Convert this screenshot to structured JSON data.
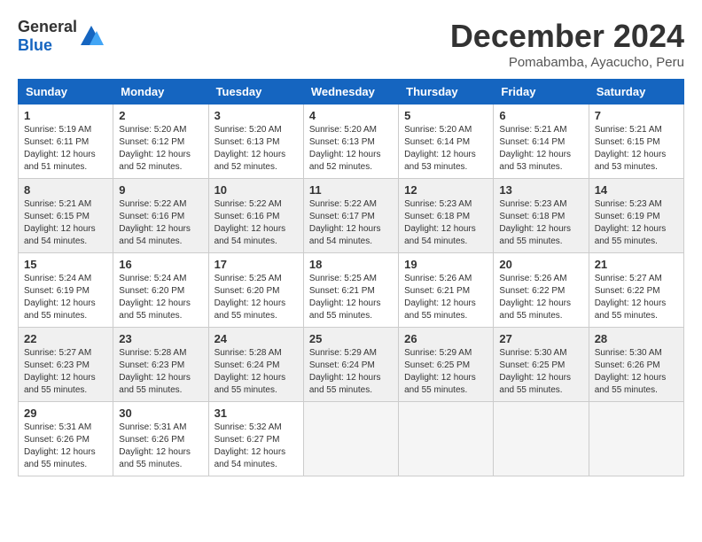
{
  "header": {
    "logo_general": "General",
    "logo_blue": "Blue",
    "title": "December 2024",
    "location": "Pomabamba, Ayacucho, Peru"
  },
  "calendar": {
    "days_of_week": [
      "Sunday",
      "Monday",
      "Tuesday",
      "Wednesday",
      "Thursday",
      "Friday",
      "Saturday"
    ],
    "weeks": [
      [
        null,
        {
          "day": "2",
          "sunrise": "Sunrise: 5:20 AM",
          "sunset": "Sunset: 6:12 PM",
          "daylight": "Daylight: 12 hours and 52 minutes."
        },
        {
          "day": "3",
          "sunrise": "Sunrise: 5:20 AM",
          "sunset": "Sunset: 6:13 PM",
          "daylight": "Daylight: 12 hours and 52 minutes."
        },
        {
          "day": "4",
          "sunrise": "Sunrise: 5:20 AM",
          "sunset": "Sunset: 6:13 PM",
          "daylight": "Daylight: 12 hours and 52 minutes."
        },
        {
          "day": "5",
          "sunrise": "Sunrise: 5:20 AM",
          "sunset": "Sunset: 6:14 PM",
          "daylight": "Daylight: 12 hours and 53 minutes."
        },
        {
          "day": "6",
          "sunrise": "Sunrise: 5:21 AM",
          "sunset": "Sunset: 6:14 PM",
          "daylight": "Daylight: 12 hours and 53 minutes."
        },
        {
          "day": "7",
          "sunrise": "Sunrise: 5:21 AM",
          "sunset": "Sunset: 6:15 PM",
          "daylight": "Daylight: 12 hours and 53 minutes."
        }
      ],
      [
        {
          "day": "1",
          "sunrise": "Sunrise: 5:19 AM",
          "sunset": "Sunset: 6:11 PM",
          "daylight": "Daylight: 12 hours and 51 minutes."
        },
        null,
        null,
        null,
        null,
        null,
        null
      ],
      [
        {
          "day": "8",
          "sunrise": "Sunrise: 5:21 AM",
          "sunset": "Sunset: 6:15 PM",
          "daylight": "Daylight: 12 hours and 54 minutes."
        },
        {
          "day": "9",
          "sunrise": "Sunrise: 5:22 AM",
          "sunset": "Sunset: 6:16 PM",
          "daylight": "Daylight: 12 hours and 54 minutes."
        },
        {
          "day": "10",
          "sunrise": "Sunrise: 5:22 AM",
          "sunset": "Sunset: 6:16 PM",
          "daylight": "Daylight: 12 hours and 54 minutes."
        },
        {
          "day": "11",
          "sunrise": "Sunrise: 5:22 AM",
          "sunset": "Sunset: 6:17 PM",
          "daylight": "Daylight: 12 hours and 54 minutes."
        },
        {
          "day": "12",
          "sunrise": "Sunrise: 5:23 AM",
          "sunset": "Sunset: 6:18 PM",
          "daylight": "Daylight: 12 hours and 54 minutes."
        },
        {
          "day": "13",
          "sunrise": "Sunrise: 5:23 AM",
          "sunset": "Sunset: 6:18 PM",
          "daylight": "Daylight: 12 hours and 55 minutes."
        },
        {
          "day": "14",
          "sunrise": "Sunrise: 5:23 AM",
          "sunset": "Sunset: 6:19 PM",
          "daylight": "Daylight: 12 hours and 55 minutes."
        }
      ],
      [
        {
          "day": "15",
          "sunrise": "Sunrise: 5:24 AM",
          "sunset": "Sunset: 6:19 PM",
          "daylight": "Daylight: 12 hours and 55 minutes."
        },
        {
          "day": "16",
          "sunrise": "Sunrise: 5:24 AM",
          "sunset": "Sunset: 6:20 PM",
          "daylight": "Daylight: 12 hours and 55 minutes."
        },
        {
          "day": "17",
          "sunrise": "Sunrise: 5:25 AM",
          "sunset": "Sunset: 6:20 PM",
          "daylight": "Daylight: 12 hours and 55 minutes."
        },
        {
          "day": "18",
          "sunrise": "Sunrise: 5:25 AM",
          "sunset": "Sunset: 6:21 PM",
          "daylight": "Daylight: 12 hours and 55 minutes."
        },
        {
          "day": "19",
          "sunrise": "Sunrise: 5:26 AM",
          "sunset": "Sunset: 6:21 PM",
          "daylight": "Daylight: 12 hours and 55 minutes."
        },
        {
          "day": "20",
          "sunrise": "Sunrise: 5:26 AM",
          "sunset": "Sunset: 6:22 PM",
          "daylight": "Daylight: 12 hours and 55 minutes."
        },
        {
          "day": "21",
          "sunrise": "Sunrise: 5:27 AM",
          "sunset": "Sunset: 6:22 PM",
          "daylight": "Daylight: 12 hours and 55 minutes."
        }
      ],
      [
        {
          "day": "22",
          "sunrise": "Sunrise: 5:27 AM",
          "sunset": "Sunset: 6:23 PM",
          "daylight": "Daylight: 12 hours and 55 minutes."
        },
        {
          "day": "23",
          "sunrise": "Sunrise: 5:28 AM",
          "sunset": "Sunset: 6:23 PM",
          "daylight": "Daylight: 12 hours and 55 minutes."
        },
        {
          "day": "24",
          "sunrise": "Sunrise: 5:28 AM",
          "sunset": "Sunset: 6:24 PM",
          "daylight": "Daylight: 12 hours and 55 minutes."
        },
        {
          "day": "25",
          "sunrise": "Sunrise: 5:29 AM",
          "sunset": "Sunset: 6:24 PM",
          "daylight": "Daylight: 12 hours and 55 minutes."
        },
        {
          "day": "26",
          "sunrise": "Sunrise: 5:29 AM",
          "sunset": "Sunset: 6:25 PM",
          "daylight": "Daylight: 12 hours and 55 minutes."
        },
        {
          "day": "27",
          "sunrise": "Sunrise: 5:30 AM",
          "sunset": "Sunset: 6:25 PM",
          "daylight": "Daylight: 12 hours and 55 minutes."
        },
        {
          "day": "28",
          "sunrise": "Sunrise: 5:30 AM",
          "sunset": "Sunset: 6:26 PM",
          "daylight": "Daylight: 12 hours and 55 minutes."
        }
      ],
      [
        {
          "day": "29",
          "sunrise": "Sunrise: 5:31 AM",
          "sunset": "Sunset: 6:26 PM",
          "daylight": "Daylight: 12 hours and 55 minutes."
        },
        {
          "day": "30",
          "sunrise": "Sunrise: 5:31 AM",
          "sunset": "Sunset: 6:26 PM",
          "daylight": "Daylight: 12 hours and 55 minutes."
        },
        {
          "day": "31",
          "sunrise": "Sunrise: 5:32 AM",
          "sunset": "Sunset: 6:27 PM",
          "daylight": "Daylight: 12 hours and 54 minutes."
        },
        null,
        null,
        null,
        null
      ]
    ]
  }
}
